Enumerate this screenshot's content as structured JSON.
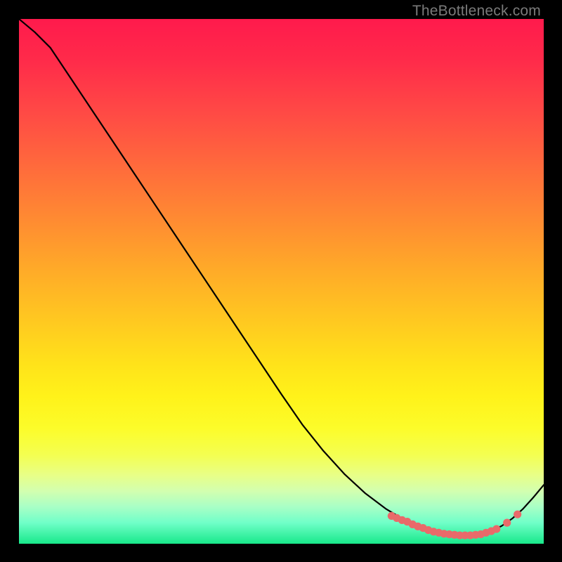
{
  "watermark": "TheBottleneck.com",
  "colors": {
    "line": "#000000",
    "marker_fill": "#e96a6a",
    "marker_stroke": "#e96a6a",
    "gradient_top": "#ff1a4c",
    "gradient_bottom": "#18e88a"
  },
  "chart_data": {
    "type": "line",
    "title": "",
    "xlabel": "",
    "ylabel": "",
    "xlim": [
      0,
      100
    ],
    "ylim": [
      0,
      100
    ],
    "grid": false,
    "legend": false,
    "x": [
      0,
      3,
      6,
      8,
      10,
      14,
      18,
      22,
      26,
      30,
      34,
      38,
      42,
      46,
      50,
      54,
      58,
      62,
      66,
      70,
      74,
      76,
      78,
      80,
      82,
      84,
      86,
      88,
      90,
      92,
      94,
      96,
      98,
      100
    ],
    "values": [
      100,
      97.5,
      94.5,
      91.5,
      88.5,
      82.5,
      76.5,
      70.5,
      64.5,
      58.5,
      52.5,
      46.5,
      40.5,
      34.5,
      28.5,
      22.7,
      17.7,
      13.3,
      9.6,
      6.6,
      4.2,
      3.3,
      2.6,
      2.1,
      1.8,
      1.6,
      1.6,
      1.8,
      2.4,
      3.4,
      4.8,
      6.6,
      8.8,
      11.2
    ],
    "markers": {
      "x": [
        71,
        72,
        73,
        74,
        75,
        76,
        77,
        78,
        79,
        80,
        81,
        82,
        83,
        84,
        85,
        86,
        87,
        88,
        89,
        90,
        91,
        93,
        95
      ],
      "y": [
        5.3,
        4.9,
        4.5,
        4.2,
        3.7,
        3.3,
        3.0,
        2.6,
        2.3,
        2.1,
        1.9,
        1.8,
        1.7,
        1.6,
        1.6,
        1.6,
        1.7,
        1.8,
        2.1,
        2.4,
        2.8,
        4.0,
        5.6
      ]
    }
  }
}
